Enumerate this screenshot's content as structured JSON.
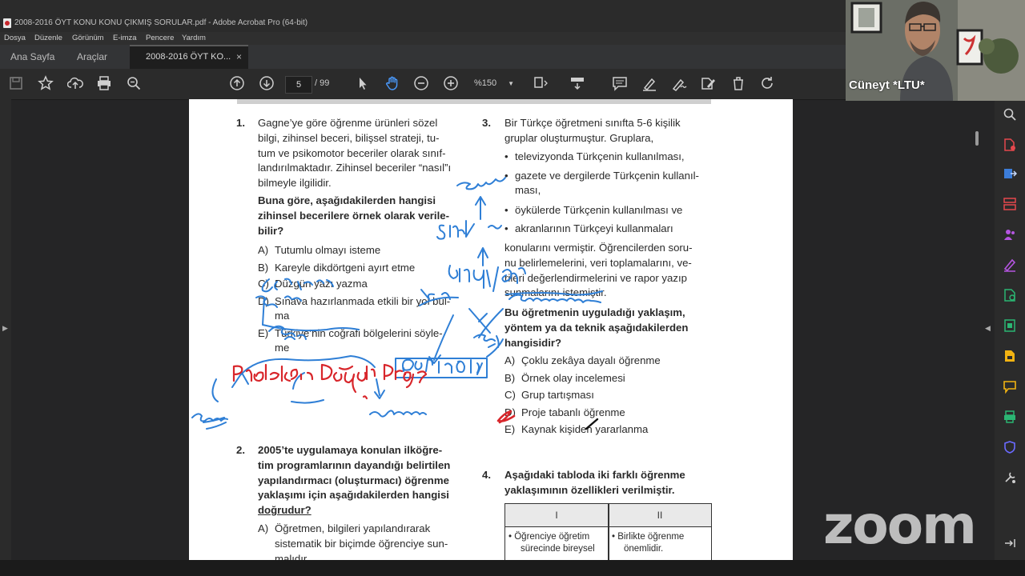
{
  "window": {
    "title": "2008-2016 ÖYT KONU KONU ÇIKMIŞ SORULAR.pdf - Adobe Acrobat Pro (64-bit)"
  },
  "menu": [
    "Dosya",
    "Düzenle",
    "Görünüm",
    "E-imza",
    "Pencere",
    "Yardım"
  ],
  "tabs": {
    "home": "Ana Sayfa",
    "tools": "Araçlar",
    "document": "2008-2016 ÖYT KO...",
    "close": "×"
  },
  "toolbar": {
    "page_current": "5",
    "page_total": "/ 99",
    "zoom": "%150"
  },
  "webcam": {
    "participant_name": "Cüneyt *LTU*"
  },
  "watermark": "zoom",
  "questions": {
    "q1": {
      "number": "1.",
      "stem": [
        "Gagne’ye göre öğrenme ürünleri sözel",
        "bilgi, zihinsel beceri, bilişsel strateji, tu-",
        "tum ve psikomotor beceriler olarak sınıf-",
        "landırılmaktadır. Zihinsel beceriler “nasıl”ı",
        "bilmeyle ilgilidir."
      ],
      "prompt": [
        "Buna göre, aşağıdakilerden hangisi",
        "zihinsel becerilere örnek olarak verile-",
        "bilir?"
      ],
      "options": [
        {
          "letter": "A)",
          "text": "Tutumlu olmayı isteme"
        },
        {
          "letter": "B)",
          "text": "Kareyle dikdörtgeni ayırt etme"
        },
        {
          "letter": "C)",
          "text": "Düzgün yazı yazma"
        },
        {
          "letter": "D)",
          "text": "Sınava hazırlanmada etkili bir yol bul-"
        },
        {
          "letter": "",
          "text": "ma"
        },
        {
          "letter": "E)",
          "text": "Türkiye’nin coğrafi bölgelerini söyle-"
        },
        {
          "letter": "",
          "text": "me"
        }
      ]
    },
    "q2": {
      "number": "2.",
      "prompt": [
        "2005’te uygulamaya konulan ilköğre-",
        "tim programlarının dayandığı belirtilen",
        "yapılandırmacı (oluşturmacı) öğrenme",
        "yaklaşımı için aşağıdakilerden hangisi",
        "doğrudur?"
      ],
      "options": [
        {
          "letter": "A)",
          "text": "Öğretmen, bilgileri yapılandırarak"
        },
        {
          "letter": "",
          "text": "sistematik bir biçimde öğrenciye sun-"
        },
        {
          "letter": "",
          "text": "malıdır."
        }
      ]
    },
    "q3": {
      "number": "3.",
      "stem": [
        "Bir Türkçe öğretmeni sınıfta 5-6 kişilik",
        "gruplar oluşturmuştur. Gruplara,"
      ],
      "bullets": [
        "televizyonda Türkçenin kullanılması,",
        "gazete ve dergilerde Türkçenin kullanıl-",
        "ması,",
        "öykülerde Türkçenin kullanılması ve",
        "akranlarının Türkçeyi kullanmaları"
      ],
      "stem2": [
        "konularını vermiştir. Öğrencilerden soru-",
        "nu belirlemelerini, veri toplamalarını, ve-",
        "rileri değerlendirmelerini ve rapor yazıp",
        "sunmalarını istemiştir."
      ],
      "prompt": [
        "Bu öğretmenin uyguladığı yaklaşım,",
        "yöntem ya da teknik aşağıdakilerden",
        "hangisidir?"
      ],
      "options": [
        {
          "letter": "A)",
          "text": "Çoklu zekâya dayalı öğrenme"
        },
        {
          "letter": "B)",
          "text": "Örnek olay incelemesi"
        },
        {
          "letter": "C)",
          "text": "Grup tartışması"
        },
        {
          "letter": "D)",
          "text": "Proje tabanlı öğrenme"
        },
        {
          "letter": "E)",
          "text": "Kaynak kişiden yararlanma"
        }
      ]
    },
    "q4": {
      "number": "4.",
      "prompt": [
        "Aşağıdaki tabloda iki farklı öğrenme",
        "yaklaşımının özellikleri verilmiştir."
      ],
      "table": {
        "headers": [
          "I",
          "II"
        ],
        "col1": [
          "Öğrenciye öğretim",
          "sürecinde bireysel"
        ],
        "col2": [
          "Birlikte öğrenme",
          "önemlidir."
        ]
      }
    }
  },
  "annotations": {
    "problem_label": "Problem Dayalı Proje",
    "case_label": "Örnek Olay",
    "handwritten": [
      "Grup",
      "Sınıf",
      "birey/öğrenci",
      "yaşam",
      "sorun",
      "kolumn",
      "yeni"
    ]
  }
}
